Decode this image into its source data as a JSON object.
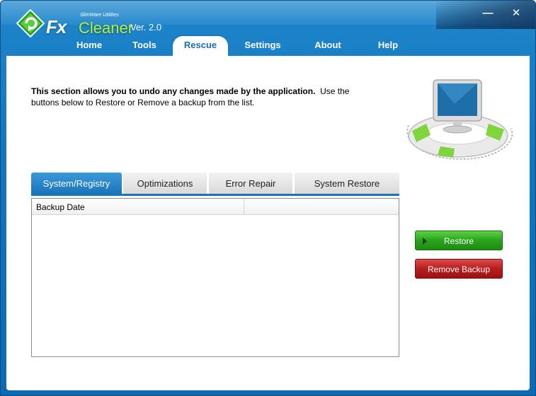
{
  "app": {
    "brand_top": "SlimWare Utilities",
    "brand_fx": "Fx",
    "brand_cleaner": "Cleaner",
    "version": "Ver. 2.0"
  },
  "window_controls": {
    "minimize": "—",
    "close": "✕"
  },
  "nav": {
    "items": [
      {
        "label": "Home"
      },
      {
        "label": "Tools"
      },
      {
        "label": "Rescue",
        "active": true
      },
      {
        "label": "Settings"
      },
      {
        "label": "About"
      },
      {
        "label": "Help"
      }
    ]
  },
  "rescue": {
    "intro_bold": "This section allows you to undo any changes made by the application.",
    "intro_rest": "Use the buttons below to Restore or Remove a backup from the list.",
    "tabs": [
      {
        "label": "System/Registry",
        "active": true
      },
      {
        "label": "Optimizations"
      },
      {
        "label": "Error Repair"
      },
      {
        "label": "System Restore"
      }
    ],
    "list": {
      "columns": [
        "Backup Date",
        ""
      ]
    },
    "buttons": {
      "restore": "Restore",
      "remove": "Remove Backup"
    }
  },
  "colors": {
    "titlebar": "#1276bd",
    "brand_green": "#b6f23a",
    "restore_green": "#28a41a",
    "remove_red": "#b81d1d",
    "active_tab_blue": "#1a74bb"
  },
  "icons": {
    "logo": "fxcleaner-logo-icon",
    "hero": "computer-lifebuoy-icon",
    "restore": "play-icon"
  }
}
